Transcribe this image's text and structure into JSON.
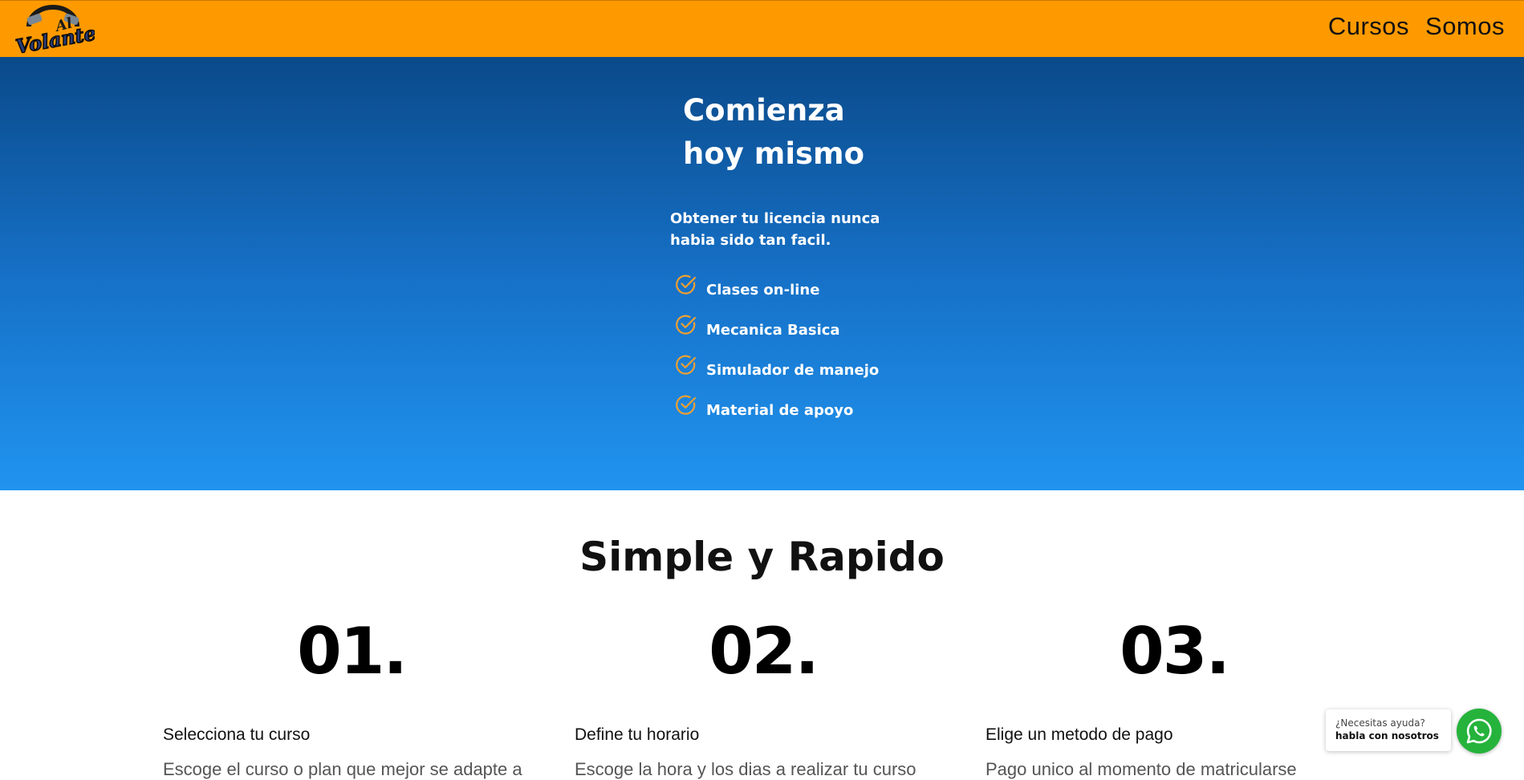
{
  "brand": {
    "logo_text_top": "Al",
    "logo_text_main": "Volante"
  },
  "nav": {
    "items": [
      {
        "label": "Cursos"
      },
      {
        "label": "Somos"
      }
    ]
  },
  "hero": {
    "title_line1": "Comienza",
    "title_line2": "hoy mismo",
    "subtitle": "Obtener tu licencia nunca habia sido tan facil.",
    "features": [
      {
        "label": "Clases on-line",
        "icon": "check-circle-icon"
      },
      {
        "label": "Mecanica Basica",
        "icon": "check-circle-icon"
      },
      {
        "label": "Simulador de manejo",
        "icon": "check-circle-icon"
      },
      {
        "label": "Material de apoyo",
        "icon": "check-circle-icon"
      }
    ]
  },
  "steps_section": {
    "title": "Simple y Rapido",
    "steps": [
      {
        "number": "01.",
        "title": "Selecciona tu curso",
        "description": "Escoge el curso o plan que mejor se adapte a"
      },
      {
        "number": "02.",
        "title": "Define tu horario",
        "description": "Escoge la hora y los dias a realizar tu curso"
      },
      {
        "number": "03.",
        "title": "Elige un metodo de pago",
        "description": "Pago unico al momento de matricularse"
      }
    ]
  },
  "help_widget": {
    "question": "¿Necesitas ayuda?",
    "cta": "habla con nosotros",
    "icon": "whatsapp-icon"
  },
  "colors": {
    "header": "#fe9a00",
    "hero_top": "#0a4a8a",
    "hero_bottom": "#2094f0",
    "check": "#f0a030",
    "whatsapp": "#25b33c"
  }
}
